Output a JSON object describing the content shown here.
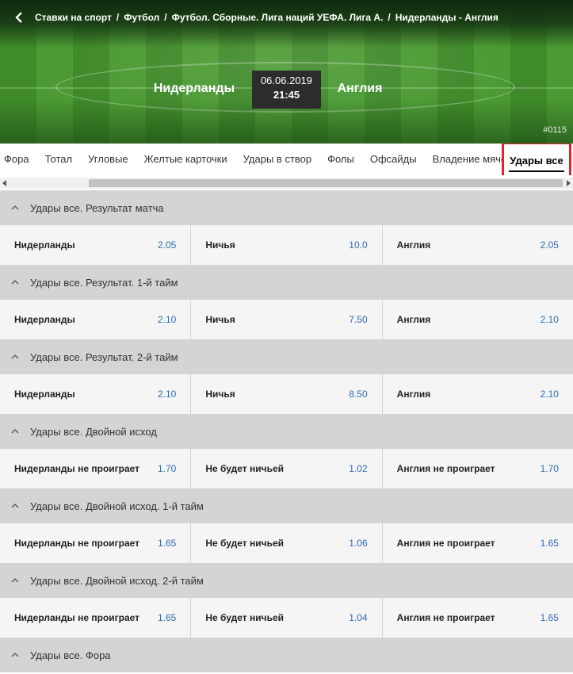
{
  "breadcrumb": {
    "items": [
      "Ставки на спорт",
      "Футбол",
      "Футбол. Сборные. Лига наций УЕФА. Лига А.",
      "Нидерланды - Англия"
    ],
    "separator": "/"
  },
  "match": {
    "home": "Нидерланды",
    "away": "Англия",
    "date": "06.06.2019",
    "time": "21:45",
    "id": "#0115"
  },
  "tabs": [
    "Фора",
    "Тотал",
    "Угловые",
    "Желтые карточки",
    "Удары в створ",
    "Фолы",
    "Офсайды",
    "Владение мячом"
  ],
  "active_tab": "Удары все",
  "colors": {
    "accent_red": "#e0262a",
    "odd_blue": "#2d6cb5",
    "header_gray": "#d4d4d4"
  },
  "markets": [
    {
      "title": "Удары все. Результат матча",
      "outcomes": [
        {
          "name": "Нидерланды",
          "odd": "2.05"
        },
        {
          "name": "Ничья",
          "odd": "10.0"
        },
        {
          "name": "Англия",
          "odd": "2.05"
        }
      ]
    },
    {
      "title": "Удары все. Результат. 1-й тайм",
      "outcomes": [
        {
          "name": "Нидерланды",
          "odd": "2.10"
        },
        {
          "name": "Ничья",
          "odd": "7.50"
        },
        {
          "name": "Англия",
          "odd": "2.10"
        }
      ]
    },
    {
      "title": "Удары все. Результат. 2-й тайм",
      "outcomes": [
        {
          "name": "Нидерланды",
          "odd": "2.10"
        },
        {
          "name": "Ничья",
          "odd": "8.50"
        },
        {
          "name": "Англия",
          "odd": "2.10"
        }
      ]
    },
    {
      "title": "Удары все. Двойной исход",
      "outcomes": [
        {
          "name": "Нидерланды не проиграет",
          "odd": "1.70"
        },
        {
          "name": "Не будет ничьей",
          "odd": "1.02"
        },
        {
          "name": "Англия не проиграет",
          "odd": "1.70"
        }
      ]
    },
    {
      "title": "Удары все. Двойной исход. 1-й тайм",
      "outcomes": [
        {
          "name": "Нидерланды не проиграет",
          "odd": "1.65"
        },
        {
          "name": "Не будет ничьей",
          "odd": "1.06"
        },
        {
          "name": "Англия не проиграет",
          "odd": "1.65"
        }
      ]
    },
    {
      "title": "Удары все. Двойной исход. 2-й тайм",
      "outcomes": [
        {
          "name": "Нидерланды не проиграет",
          "odd": "1.65"
        },
        {
          "name": "Не будет ничьей",
          "odd": "1.04"
        },
        {
          "name": "Англия не проиграет",
          "odd": "1.65"
        }
      ]
    },
    {
      "title": "Удары все. Фора",
      "outcomes": []
    }
  ]
}
